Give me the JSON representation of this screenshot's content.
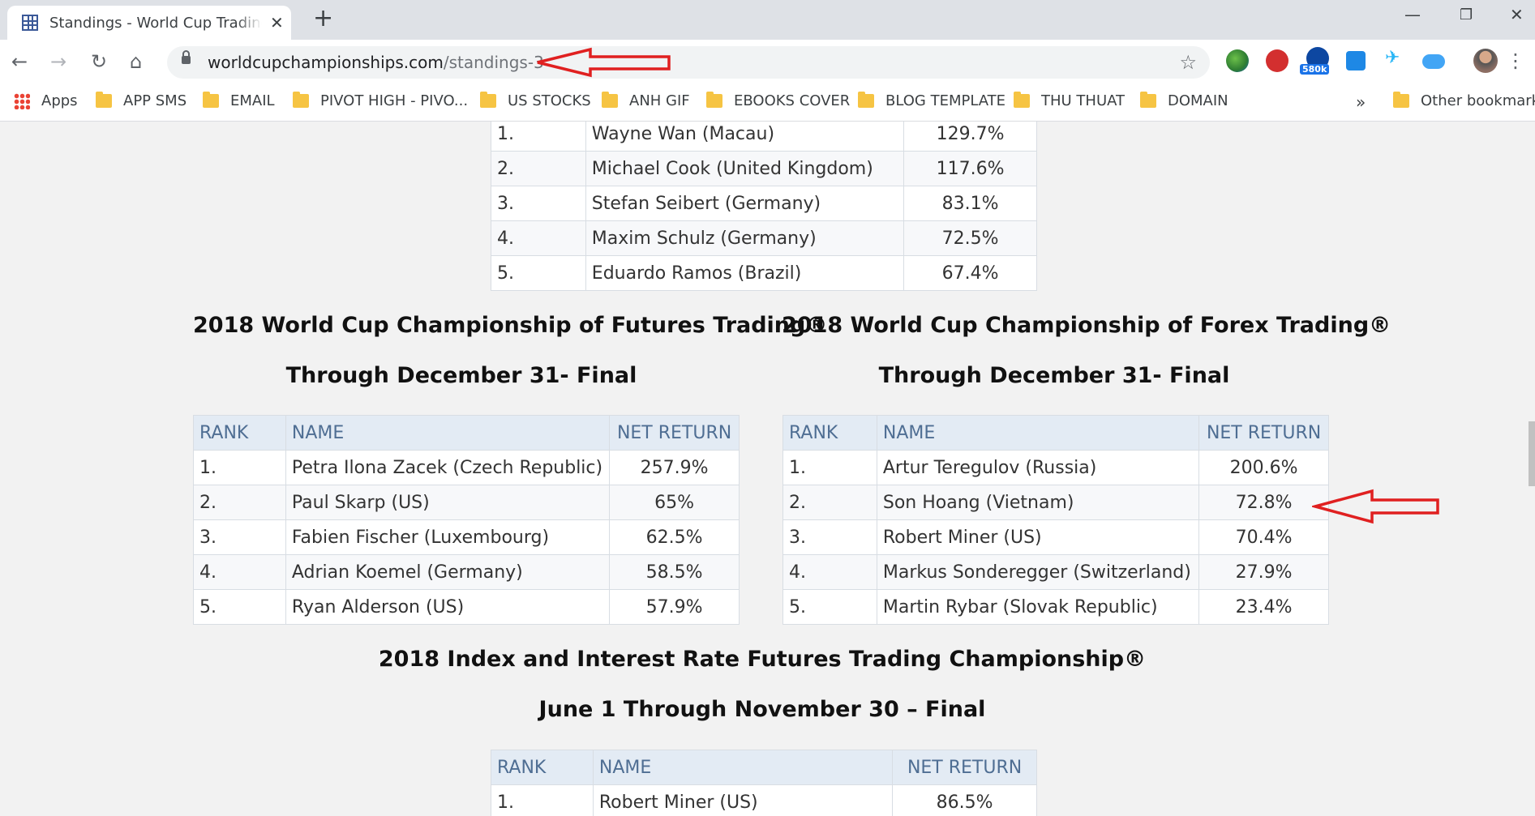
{
  "browser": {
    "tab_title": "Standings - World Cup Trading Championships",
    "url_host": "worldcupchampionships.com",
    "url_path": "/standings-3",
    "extension_badge": "580k",
    "bookmarks": [
      {
        "label": "Apps"
      },
      {
        "label": "APP SMS"
      },
      {
        "label": "EMAIL"
      },
      {
        "label": "PIVOT HIGH - PIVO..."
      },
      {
        "label": "US STOCKS"
      },
      {
        "label": "ANH GIF"
      },
      {
        "label": "EBOOKS COVER"
      },
      {
        "label": "BLOG TEMPLATE"
      },
      {
        "label": "THU THUAT"
      },
      {
        "label": "DOMAIN"
      }
    ],
    "overflow_chevron": "»",
    "other_bookmarks": "Other bookmarks"
  },
  "tables": {
    "top": {
      "rows": [
        {
          "rank": "1.",
          "name": "Wayne Wan (Macau)",
          "ret": "129.7%"
        },
        {
          "rank": "2.",
          "name": "Michael Cook (United Kingdom)",
          "ret": "117.6%"
        },
        {
          "rank": "3.",
          "name": "Stefan Seibert (Germany)",
          "ret": "83.1%"
        },
        {
          "rank": "4.",
          "name": "Maxim Schulz (Germany)",
          "ret": "72.5%"
        },
        {
          "rank": "5.",
          "name": "Eduardo Ramos (Brazil)",
          "ret": "67.4%"
        }
      ]
    },
    "futures": {
      "title": "2018 World Cup Championship of Futures Trading®",
      "subtitle": "Through December 31- Final",
      "headers": {
        "rank": "RANK",
        "name": "NAME",
        "ret": "NET RETURN"
      },
      "rows": [
        {
          "rank": "1.",
          "name": "Petra Ilona Zacek (Czech Republic)",
          "ret": "257.9%"
        },
        {
          "rank": "2.",
          "name": "Paul Skarp (US)",
          "ret": "65%"
        },
        {
          "rank": "3.",
          "name": "Fabien Fischer (Luxembourg)",
          "ret": "62.5%"
        },
        {
          "rank": "4.",
          "name": "Adrian Koemel (Germany)",
          "ret": "58.5%"
        },
        {
          "rank": "5.",
          "name": "Ryan Alderson (US)",
          "ret": "57.9%"
        }
      ]
    },
    "forex": {
      "title": "2018 World Cup Championship of Forex Trading®",
      "subtitle": "Through December 31- Final",
      "headers": {
        "rank": "RANK",
        "name": "NAME",
        "ret": "NET RETURN"
      },
      "rows": [
        {
          "rank": "1.",
          "name": "Artur Teregulov (Russia)",
          "ret": "200.6%"
        },
        {
          "rank": "2.",
          "name": "Son Hoang (Vietnam)",
          "ret": "72.8%"
        },
        {
          "rank": "3.",
          "name": "Robert Miner (US)",
          "ret": "70.4%"
        },
        {
          "rank": "4.",
          "name": "Markus Sonderegger (Switzerland)",
          "ret": "27.9%"
        },
        {
          "rank": "5.",
          "name": "Martin Rybar (Slovak Republic)",
          "ret": "23.4%"
        }
      ]
    },
    "index": {
      "title": "2018 Index and Interest Rate Futures Trading Championship®",
      "subtitle": "June 1 Through November 30 – Final",
      "headers": {
        "rank": "RANK",
        "name": "NAME",
        "ret": "NET RETURN"
      },
      "rows": [
        {
          "rank": "1.",
          "name": "Robert Miner (US)",
          "ret": "86.5%"
        }
      ]
    }
  },
  "annotation_color": "#e02020"
}
